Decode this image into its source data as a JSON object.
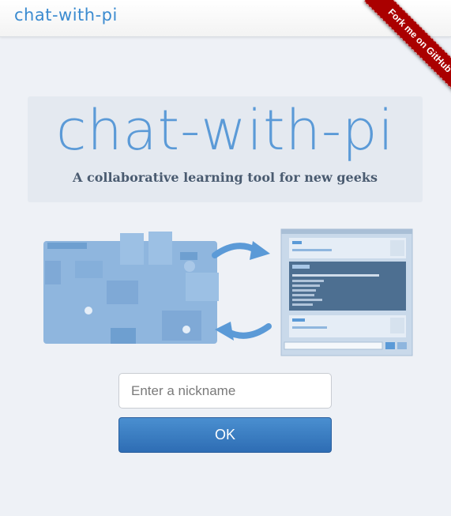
{
  "navbar": {
    "brand": "chat-with-pi"
  },
  "ribbon": {
    "label": "Fork me on GitHub"
  },
  "hero": {
    "title": "chat-with-pi",
    "subtitle": "A collaborative learning tool for new geeks"
  },
  "form": {
    "nickname_placeholder": "Enter a nickname",
    "nickname_value": "",
    "ok_label": "OK"
  },
  "colors": {
    "accent": "#3b8bd0",
    "background": "#eef1f6",
    "ribbon": "#aa0000",
    "button": "#3a7dc4"
  }
}
